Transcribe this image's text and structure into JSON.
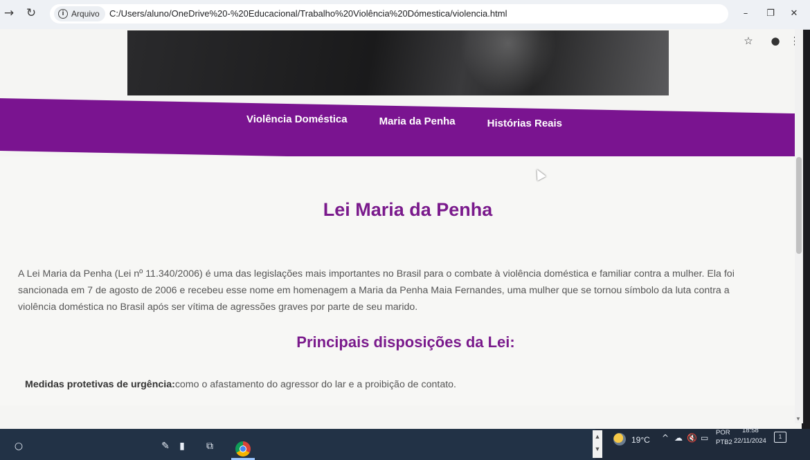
{
  "browser": {
    "back_icon": "back-arrow-icon",
    "reload_icon": "reload-icon",
    "security_chip_label": "Arquivo",
    "url": "C:/Users/aluno/OneDrive%20-%20Educacional/Trabalho%20Violência%20Dómestica/violencia.html",
    "bookmark_icon": "star-icon",
    "profile_icon": "profile-icon",
    "menu_icon": "kebab-menu-icon",
    "window_controls": [
      "minimize",
      "restore",
      "close"
    ]
  },
  "page": {
    "nav": {
      "items": [
        {
          "label": "Violência Doméstica"
        },
        {
          "label": "Maria da Penha"
        },
        {
          "label": "Histórias Reais"
        }
      ]
    },
    "title": "Lei Maria da Penha",
    "intro": "A Lei Maria da Penha (Lei nº 11.340/2006) é uma das legislações mais importantes no Brasil para o combate à violência doméstica e familiar contra a mulher. Ela foi sancionada em 7 de agosto de 2006 e recebeu esse nome em homenagem a Maria da Penha Maia Fernandes, uma mulher que se tornou símbolo da luta contra a violência doméstica no Brasil após ser vítima de agressões graves por parte de seu marido.",
    "section_title": "Principais disposições da Lei:",
    "provisions": [
      {
        "term": "Medidas protetivas de urgência:",
        "text": "como o afastamento do agressor do lar e a proibição de contato."
      }
    ]
  },
  "taskbar": {
    "temperature": "19°C",
    "language": "POR",
    "layout": "PTB2",
    "time": "18:58",
    "date": "22/11/2024",
    "notification_count": "1"
  },
  "colors": {
    "nav_bg": "#7a1490",
    "heading": "#7a1a8c"
  }
}
